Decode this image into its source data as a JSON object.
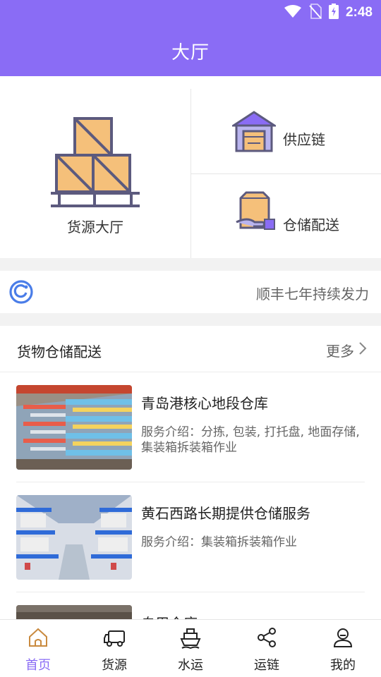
{
  "status_bar": {
    "time": "2:48"
  },
  "header": {
    "title": "大厅"
  },
  "hero": {
    "main_label": "货源大厅",
    "services": [
      {
        "label": "供应链",
        "icon": "warehouse-icon"
      },
      {
        "label": "仓储配送",
        "icon": "package-hand-icon"
      }
    ]
  },
  "notice": {
    "text": "顺丰七年持续发力"
  },
  "section": {
    "title": "货物仓储配送",
    "more_label": "更多",
    "items": [
      {
        "name": "青岛港核心地段仓库",
        "desc": "服务介绍：分拣, 包装, 打托盘, 地面存储, 集装箱拆装箱作业"
      },
      {
        "name": "黄石西路长期提供仓储服务",
        "desc": "服务介绍：集装箱拆装箱作业"
      },
      {
        "name": "自用仓库",
        "desc": ""
      }
    ]
  },
  "tabbar": {
    "tabs": [
      {
        "label": "首页",
        "icon": "home-icon",
        "active": true
      },
      {
        "label": "货源",
        "icon": "truck-icon"
      },
      {
        "label": "水运",
        "icon": "ship-icon"
      },
      {
        "label": "运链",
        "icon": "share-icon"
      },
      {
        "label": "我的",
        "icon": "user-icon"
      }
    ]
  },
  "colors": {
    "accent": "#8a6cf5",
    "box": "#f5c07a",
    "outline": "#5c5a7e"
  }
}
